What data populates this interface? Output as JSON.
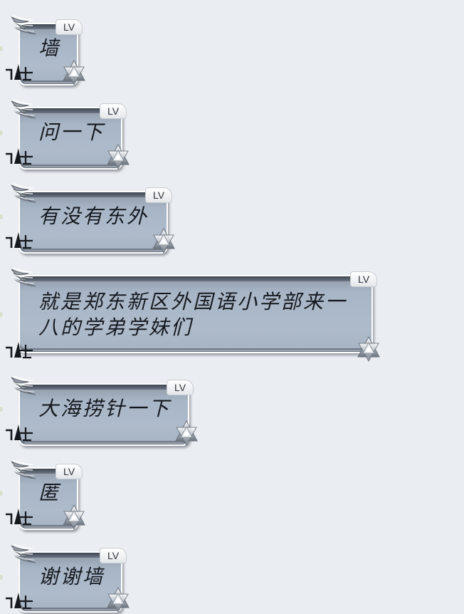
{
  "conversation": {
    "messages": [
      {
        "text": "墙",
        "level_badge": "LV",
        "avatar_icon": "wing-icon",
        "corner_icon": "star-icon",
        "tail_icon": "glyph-icon"
      },
      {
        "text": "问一下",
        "level_badge": "LV",
        "avatar_icon": "wing-icon",
        "corner_icon": "star-icon",
        "tail_icon": "glyph-icon"
      },
      {
        "text": "有没有东外",
        "level_badge": "LV",
        "avatar_icon": "wing-icon",
        "corner_icon": "star-icon",
        "tail_icon": "glyph-icon"
      },
      {
        "text": "就是郑东新区外国语小学部来一",
        "text_line2": "八的学弟学妹们",
        "level_badge": "LV",
        "avatar_icon": "wing-icon",
        "corner_icon": "star-icon",
        "tail_icon": "glyph-icon"
      },
      {
        "text": "大海捞针一下",
        "level_badge": "LV",
        "avatar_icon": "wing-icon",
        "corner_icon": "star-icon",
        "tail_icon": "glyph-icon"
      },
      {
        "text": "匿",
        "level_badge": "LV",
        "avatar_icon": "wing-icon",
        "corner_icon": "star-icon",
        "tail_icon": "glyph-icon"
      },
      {
        "text": "谢谢墙",
        "level_badge": "LV",
        "avatar_icon": "wing-icon",
        "corner_icon": "star-icon",
        "tail_icon": "glyph-icon"
      }
    ]
  },
  "theme": {
    "background": "#eaedf1",
    "bubble_top": "#8e98a4",
    "bubble_body": "#aebbcb",
    "bubble_border": "#ffffff",
    "text_color": "#15191f"
  }
}
